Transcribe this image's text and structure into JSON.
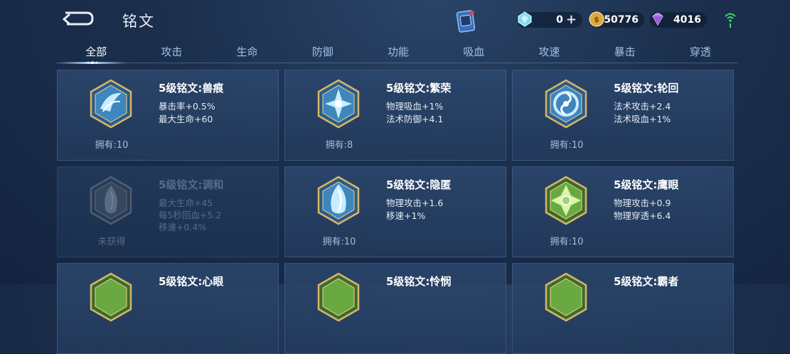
{
  "header": {
    "title": "铭文",
    "currencies": [
      {
        "name": "diamond",
        "value": "0",
        "icon": "diamond-icon",
        "color": "#8fe3f5"
      },
      {
        "name": "gold",
        "value": "50776",
        "icon": "gold-coin-icon",
        "color": "#e7b24a"
      },
      {
        "name": "gem",
        "value": "4016",
        "icon": "purple-gem-icon",
        "color": "#b77cf0"
      }
    ]
  },
  "tabs": [
    "全部",
    "攻击",
    "生命",
    "防御",
    "功能",
    "吸血",
    "攻速",
    "暴击",
    "穿透"
  ],
  "active_tab": "全部",
  "cards": [
    {
      "name": "5级铭文:兽痕",
      "stats": [
        "暴击率+0.5%",
        "最大生命+60"
      ],
      "owned": "拥有:10",
      "color": "blue"
    },
    {
      "name": "5级铭文:繁荣",
      "stats": [
        "物理吸血+1%",
        "法术防御+4.1"
      ],
      "owned": "拥有:8",
      "color": "blue"
    },
    {
      "name": "5级铭文:轮回",
      "stats": [
        "法术攻击+2.4",
        "法术吸血+1%"
      ],
      "owned": "拥有:10",
      "color": "blue"
    },
    {
      "name": "5级铭文:调和",
      "stats": [
        "最大生命+45",
        "每5秒回血+5.2",
        "移速+0.4%"
      ],
      "owned": "未获得",
      "color": "blue",
      "locked": true
    },
    {
      "name": "5级铭文:隐匿",
      "stats": [
        "物理攻击+1.6",
        "移速+1%"
      ],
      "owned": "拥有:10",
      "color": "blue"
    },
    {
      "name": "5级铭文:鹰眼",
      "stats": [
        "物理攻击+0.9",
        "物理穿透+6.4"
      ],
      "owned": "拥有:10",
      "color": "green"
    },
    {
      "name": "5级铭文:心眼",
      "stats": [],
      "owned": "",
      "color": "green"
    },
    {
      "name": "5级铭文:怜悯",
      "stats": [],
      "owned": "",
      "color": "green"
    },
    {
      "name": "5级铭文:霸者",
      "stats": [],
      "owned": "",
      "color": "green"
    }
  ]
}
